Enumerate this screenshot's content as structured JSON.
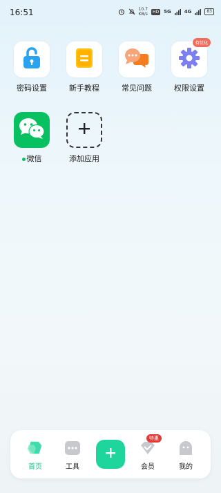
{
  "status_bar": {
    "time": "16:51",
    "net_speed_value": "10.7",
    "net_speed_unit": "KB/s",
    "hd_label": "HD",
    "signal1": "5G",
    "signal2": "4G",
    "battery": "83"
  },
  "apps": [
    {
      "label": "密码设置",
      "icon": "unlock-icon"
    },
    {
      "label": "新手教程",
      "icon": "document-icon"
    },
    {
      "label": "常见问题",
      "icon": "chat-bubbles-icon"
    },
    {
      "label": "权限设置",
      "icon": "gear-icon",
      "badge": "待优化"
    },
    {
      "label": "微信",
      "icon": "wechat-icon"
    },
    {
      "label": "添加应用",
      "icon": "plus-icon"
    }
  ],
  "bottom_nav": {
    "home": "首页",
    "tools": "工具",
    "vip": "会员",
    "vip_badge": "特惠",
    "mine": "我的"
  },
  "colors": {
    "accent": "#1ed59b",
    "wechat": "#07c160",
    "badge": "#f36b5b"
  }
}
